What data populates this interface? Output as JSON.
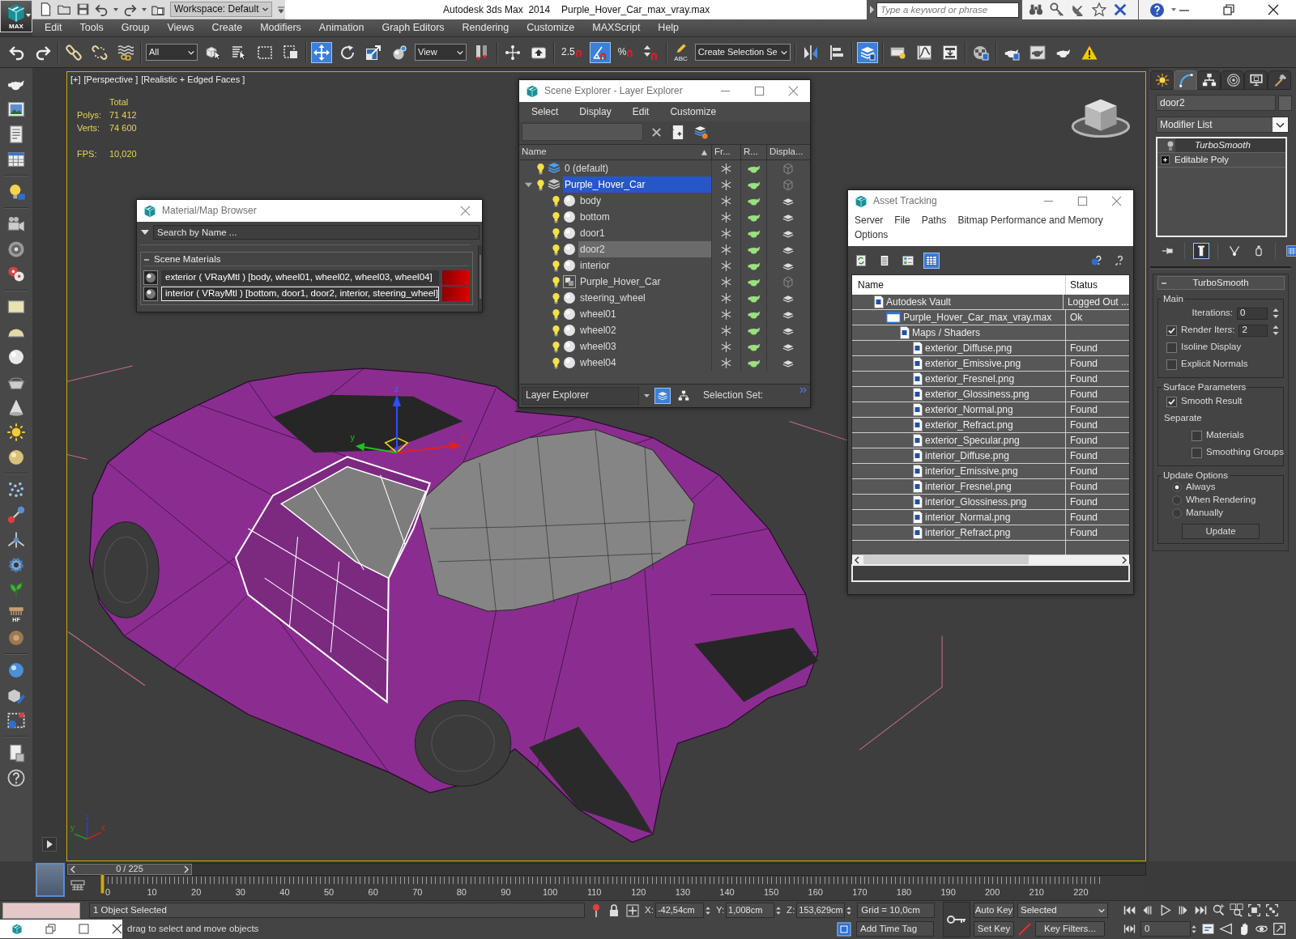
{
  "app": {
    "logo_label": "MAX",
    "workspace": "Workspace: Default",
    "product": "Autodesk 3ds Max  2014",
    "file": "Purple_Hover_Car_max_vray.max",
    "search": {
      "placeholder": "Type a keyword or phrase"
    }
  },
  "menu": [
    "Edit",
    "Tools",
    "Group",
    "Views",
    "Create",
    "Modifiers",
    "Animation",
    "Graph Editors",
    "Rendering",
    "Customize",
    "MAXScript",
    "Help"
  ],
  "main_toolbar": [
    [
      {
        "kind": "undo",
        "on": false
      },
      {
        "kind": "redo",
        "on": false
      }
    ],
    [
      {
        "kind": "link",
        "on": false
      },
      {
        "kind": "unlink",
        "on": false
      },
      {
        "kind": "bind",
        "on": false
      }
    ],
    [
      {
        "kind": "dropdown",
        "value": "All",
        "on": false
      },
      {
        "kind": "select",
        "on": false
      },
      {
        "kind": "select_by_name",
        "on": false
      },
      {
        "kind": "region",
        "on": false
      },
      {
        "kind": "crossing",
        "on": false
      }
    ],
    [
      {
        "kind": "move",
        "on": true
      },
      {
        "kind": "rotate",
        "on": false
      },
      {
        "kind": "scale",
        "on": false
      },
      {
        "kind": "place",
        "on": false
      },
      {
        "kind": "dropdown",
        "value": "View",
        "on": false
      },
      {
        "kind": "pivot",
        "on": false
      }
    ],
    [
      {
        "kind": "manipulate",
        "on": false
      },
      {
        "kind": "shortcut",
        "on": false
      }
    ],
    [
      {
        "kind": "snap",
        "label": "2.5",
        "on": false
      },
      {
        "kind": "angle_snap",
        "on": true
      },
      {
        "kind": "percent_snap",
        "label": "%",
        "on": false
      },
      {
        "kind": "spinner_snap",
        "on": false
      }
    ],
    [
      {
        "kind": "named_sets",
        "label": "ABC",
        "on": false
      },
      {
        "kind": "dropdown",
        "value": "Create Selection Se",
        "on": false
      }
    ],
    [
      {
        "kind": "mirror",
        "on": false
      },
      {
        "kind": "align",
        "on": false
      }
    ],
    [
      {
        "kind": "layers",
        "on": true
      }
    ],
    [
      {
        "kind": "ribbon",
        "on": false
      },
      {
        "kind": "curve_editor",
        "on": false
      },
      {
        "kind": "schematic",
        "on": false
      }
    ],
    [
      {
        "kind": "material_editor",
        "on": false
      }
    ],
    [
      {
        "kind": "render_setup",
        "on": false
      },
      {
        "kind": "frame_window",
        "on": false
      },
      {
        "kind": "render",
        "on": false
      },
      {
        "kind": "warning",
        "on": false
      }
    ]
  ],
  "left_toolbar": {
    "icon_label": "HF"
  },
  "viewport": {
    "labels": [
      "[+]",
      "[Perspective ]",
      "[Realistic + Edged Faces ]"
    ],
    "stats": {
      "header": "Total",
      "counts": [
        {
          "label": "Polys:",
          "value": "71 412"
        },
        {
          "label": "Verts:",
          "value": "74 600"
        }
      ],
      "fps": {
        "label": "FPS:",
        "value": "10,020"
      }
    },
    "gizmo_axes": [
      "z",
      "y",
      "x"
    ],
    "tripod_axes": [
      "z",
      "y",
      "x"
    ]
  },
  "material_browser": {
    "title": "Material/Map Browser",
    "search": {
      "placeholder": "Search by Name ..."
    },
    "group": {
      "label": "Scene Materials",
      "expanded": true,
      "items": [
        {
          "name": "exterior ( VRayMtl ) [body, wheel01, wheel02, wheel03, wheel04]",
          "selected": false
        },
        {
          "name": "interior ( VRayMtl ) [bottom, door1, door2, interior, steering_wheel]",
          "selected": true
        }
      ]
    }
  },
  "scene_explorer": {
    "title": "Scene Explorer - Layer Explorer",
    "menu": [
      "Select",
      "Display",
      "Edit",
      "Customize"
    ],
    "columns": [
      "Name",
      "Fr...",
      "R...",
      "Displa..."
    ],
    "rows": [
      {
        "kind": "layer",
        "name": "0 (default)",
        "current": true,
        "selected": false
      },
      {
        "kind": "layer",
        "name": "Purple_Hover_Car",
        "current": false,
        "selected": true,
        "expanded": true,
        "children": [
          {
            "kind": "object",
            "name": "body",
            "selected": false
          },
          {
            "kind": "object",
            "name": "bottom",
            "selected": false
          },
          {
            "kind": "object",
            "name": "door1",
            "selected": false
          },
          {
            "kind": "object",
            "name": "door2",
            "selected": true
          },
          {
            "kind": "object",
            "name": "interior",
            "selected": false
          },
          {
            "kind": "group",
            "name": "Purple_Hover_Car",
            "selected": false
          },
          {
            "kind": "object",
            "name": "steering_wheel",
            "selected": false
          },
          {
            "kind": "object",
            "name": "wheel01",
            "selected": false
          },
          {
            "kind": "object",
            "name": "wheel02",
            "selected": false
          },
          {
            "kind": "object",
            "name": "wheel03",
            "selected": false
          },
          {
            "kind": "object",
            "name": "wheel04",
            "selected": false
          }
        ]
      }
    ],
    "footer": {
      "mode": "Layer Explorer",
      "selection_set": "Selection Set:"
    },
    "footer_toggles": [
      {
        "kind": "layers",
        "on": true
      },
      {
        "kind": "hierarchy",
        "on": false
      }
    ]
  },
  "asset_tracking": {
    "title": "Asset Tracking",
    "menu": [
      "Server",
      "File",
      "Paths",
      "Bitmap Performance and Memory",
      "Options"
    ],
    "toolbar": [
      {
        "kind": "refresh",
        "on": false
      },
      {
        "kind": "list",
        "on": false
      },
      {
        "kind": "thumbnails",
        "on": false
      },
      {
        "kind": "table",
        "on": true
      }
    ],
    "columns": [
      "Name",
      "Status"
    ],
    "rows": [
      {
        "kind": "provider",
        "name": "Autodesk Vault",
        "status": "Logged Out ...",
        "children": [
          {
            "kind": "file",
            "name": "Purple_Hover_Car_max_vray.max",
            "status": "Ok",
            "children": [
              {
                "kind": "folder",
                "name": "Maps / Shaders",
                "children": [
                  {
                    "kind": "bitmap",
                    "name": "exterior_Diffuse.png",
                    "status": "Found"
                  },
                  {
                    "kind": "bitmap",
                    "name": "exterior_Emissive.png",
                    "status": "Found"
                  },
                  {
                    "kind": "bitmap",
                    "name": "exterior_Fresnel.png",
                    "status": "Found"
                  },
                  {
                    "kind": "bitmap",
                    "name": "exterior_Glossiness.png",
                    "status": "Found"
                  },
                  {
                    "kind": "bitmap",
                    "name": "exterior_Normal.png",
                    "status": "Found"
                  },
                  {
                    "kind": "bitmap",
                    "name": "exterior_Refract.png",
                    "status": "Found"
                  },
                  {
                    "kind": "bitmap",
                    "name": "exterior_Specular.png",
                    "status": "Found"
                  },
                  {
                    "kind": "bitmap",
                    "name": "interior_Diffuse.png",
                    "status": "Found"
                  },
                  {
                    "kind": "bitmap",
                    "name": "interior_Emissive.png",
                    "status": "Found"
                  },
                  {
                    "kind": "bitmap",
                    "name": "interior_Fresnel.png",
                    "status": "Found"
                  },
                  {
                    "kind": "bitmap",
                    "name": "interior_Glossiness.png",
                    "status": "Found"
                  },
                  {
                    "kind": "bitmap",
                    "name": "interior_Normal.png",
                    "status": "Found"
                  },
                  {
                    "kind": "bitmap",
                    "name": "interior_Refract.png",
                    "status": "Found"
                  }
                ]
              }
            ]
          }
        ]
      }
    ]
  },
  "command_panel": {
    "tabs": [
      {
        "kind": "create",
        "selected": false
      },
      {
        "kind": "modify",
        "selected": true
      },
      {
        "kind": "hierarchy",
        "selected": false
      },
      {
        "kind": "motion",
        "selected": false
      },
      {
        "kind": "display",
        "selected": false
      },
      {
        "kind": "utilities",
        "selected": false
      }
    ],
    "object_name": "door2",
    "modifier_list": "Modifier List",
    "stack": [
      {
        "kind": "modifier",
        "name": "TurboSmooth",
        "instanced": true,
        "selected": true
      },
      {
        "kind": "base",
        "name": "Editable Poly",
        "instanced": false,
        "selected": false
      }
    ],
    "stack_tools": [
      {
        "kind": "pin",
        "on": false
      },
      {
        "kind": "end_result",
        "on": true
      },
      {
        "kind": "make_unique",
        "on": false
      },
      {
        "kind": "remove",
        "on": false
      },
      {
        "kind": "configure",
        "on": false
      }
    ],
    "rollout": {
      "title": "TurboSmooth",
      "expanded": true,
      "groups": [
        {
          "title": "Main",
          "controls": [
            {
              "kind": "spinner",
              "label": "Iterations:",
              "value": "0"
            },
            {
              "kind": "check_spinner",
              "label": "Render Iters:",
              "value": "2",
              "checked": true
            },
            {
              "kind": "checkbox",
              "label": "Isoline Display",
              "checked": false
            },
            {
              "kind": "checkbox",
              "label": "Explicit Normals",
              "checked": false
            }
          ]
        },
        {
          "title": "Surface Parameters",
          "controls": [
            {
              "kind": "checkbox",
              "label": "Smooth Result",
              "checked": true
            },
            {
              "kind": "label",
              "label": "Separate"
            },
            {
              "kind": "sub_checkbox",
              "label": "Materials",
              "checked": false
            },
            {
              "kind": "sub_checkbox",
              "label": "Smoothing Groups",
              "checked": false
            }
          ]
        },
        {
          "title": "Update Options",
          "controls": [
            {
              "kind": "radio",
              "label": "Always",
              "selected": true
            },
            {
              "kind": "radio",
              "label": "When Rendering",
              "selected": false
            },
            {
              "kind": "radio",
              "label": "Manually",
              "selected": false
            },
            {
              "kind": "button",
              "label": "Update"
            }
          ]
        }
      ]
    }
  },
  "timeline": {
    "position": "0 / 225",
    "level": 0,
    "ticks": [
      "0",
      "10",
      "20",
      "30",
      "40",
      "50",
      "60",
      "70",
      "80",
      "90",
      "100",
      "110",
      "120",
      "130",
      "140",
      "150",
      "160",
      "170",
      "180",
      "190",
      "200",
      "210",
      "220"
    ]
  },
  "status_bar": {
    "selection": "1 Object Selected",
    "prompt": "drag to select and move objects",
    "coordinates": [
      {
        "axis": "X:",
        "value": "-42,54cm"
      },
      {
        "axis": "Y:",
        "value": "1,008cm"
      },
      {
        "axis": "Z:",
        "value": "153,629cm"
      }
    ],
    "grid": "Grid = 10,0cm",
    "time_tag": "Add Time Tag"
  },
  "animation_controls": {
    "auto_key": "Auto Key",
    "key_mode": "Selected",
    "set_key": "Set Key",
    "key_filters": "Key Filters...",
    "frame": "0"
  }
}
